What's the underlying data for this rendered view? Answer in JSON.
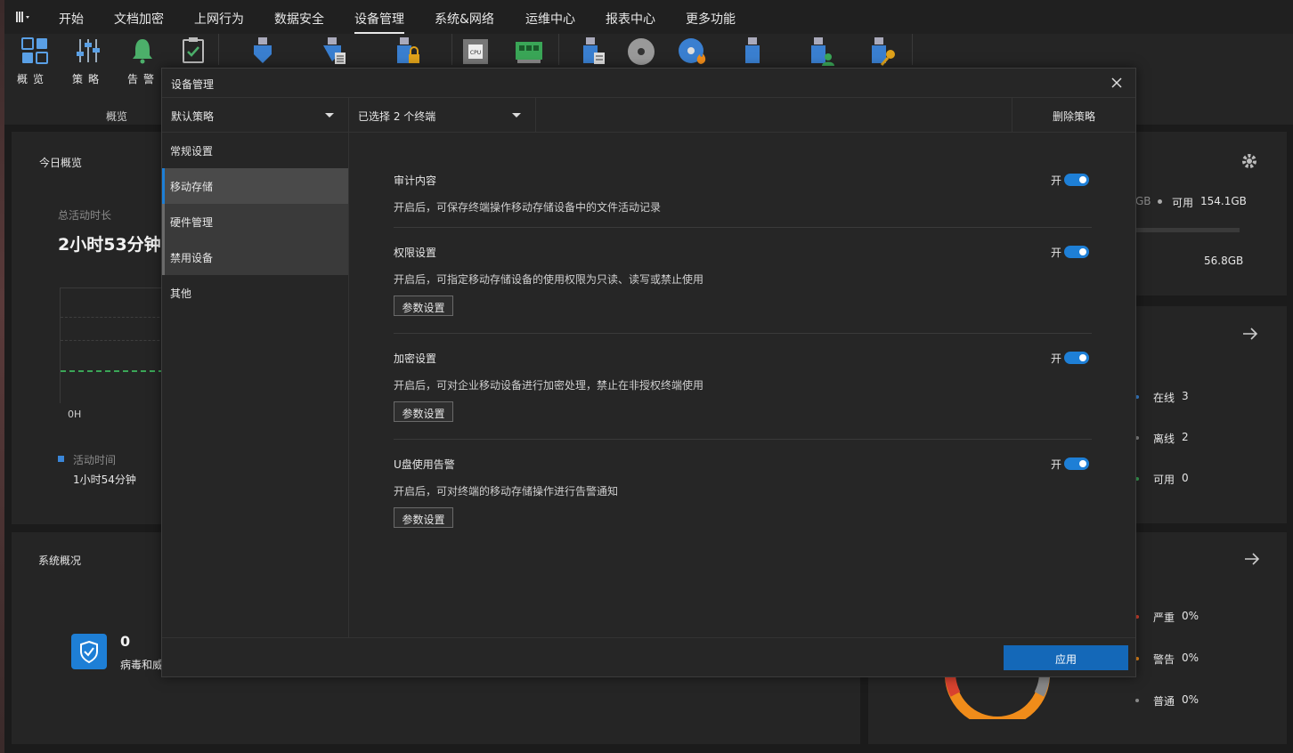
{
  "menu": {
    "items": [
      "开始",
      "文档加密",
      "上网行为",
      "数据安全",
      "设备管理",
      "系统&网络",
      "运维中心",
      "报表中心",
      "更多功能"
    ],
    "active_index": 4
  },
  "toolbar": {
    "buttons": [
      {
        "label": "概览",
        "icon": "dashboard-grid-icon"
      },
      {
        "label": "策略",
        "icon": "sliders-icon"
      },
      {
        "label": "告警",
        "icon": "bell-icon"
      }
    ],
    "group_label": "概览",
    "more_icons": [
      "usb-shield-icon",
      "usb-file-icon",
      "usb-lock-icon",
      "cpu-icon",
      "memory-board-icon",
      "usb-doc-icon",
      "disc-icon",
      "disc-burn-icon",
      "usb-drive-icon",
      "usb-user-icon",
      "usb-key-icon"
    ]
  },
  "overview": {
    "title": "今日概览",
    "total_label": "总活动时长",
    "total_value": "2小时53分钟",
    "axis_label": "0H",
    "legend_label": "活动时间",
    "legend_value": "1小时54分钟",
    "legend_color": "#3a86d8"
  },
  "disk": {
    "partial_total": "GB",
    "available_label": "可用",
    "available_value": "154.1GB",
    "used_value": "56.8GB"
  },
  "terminals": {
    "online_label": "在线",
    "online_count": "3",
    "offline_label": "离线",
    "offline_count": "2",
    "usable_label": "可用",
    "usable_count": "0"
  },
  "system": {
    "title": "系统概况",
    "virus_count": "0",
    "virus_label": "病毒和威"
  },
  "alerts": {
    "severe_label": "严重",
    "severe_value": "0%",
    "warning_label": "警告",
    "warning_value": "0%",
    "normal_label": "普通",
    "normal_value": "0%"
  },
  "modal": {
    "title": "设备管理",
    "policy_select": "默认策略",
    "terminal_select": "已选择 2 个终端",
    "delete_label": "删除策略",
    "sidebar": [
      "常规设置",
      "移动存储",
      "硬件管理",
      "禁用设备",
      "其他"
    ],
    "sections": [
      {
        "title": "审计内容",
        "toggle": "开",
        "desc": "开启后，可保存终端操作移动存储设备中的文件活动记录"
      },
      {
        "title": "权限设置",
        "toggle": "开",
        "desc": "开启后，可指定移动存储设备的使用权限为只读、读写或禁止使用",
        "button": "参数设置"
      },
      {
        "title": "加密设置",
        "toggle": "开",
        "desc": "开启后，可对企业移动设备进行加密处理，禁止在非授权终端使用",
        "button": "参数设置"
      },
      {
        "title": "U盘使用告警",
        "toggle": "开",
        "desc": "开启后，可对终端的移动存储操作进行告警通知",
        "button": "参数设置"
      }
    ],
    "apply_label": "应用"
  },
  "colors": {
    "accent": "#1e7fd6",
    "apply": "#1468b8",
    "donut_orange": "#f08c1a",
    "donut_red": "#d9432f",
    "online_dot": "#3a86d8",
    "usable_dot": "#3aa657"
  }
}
